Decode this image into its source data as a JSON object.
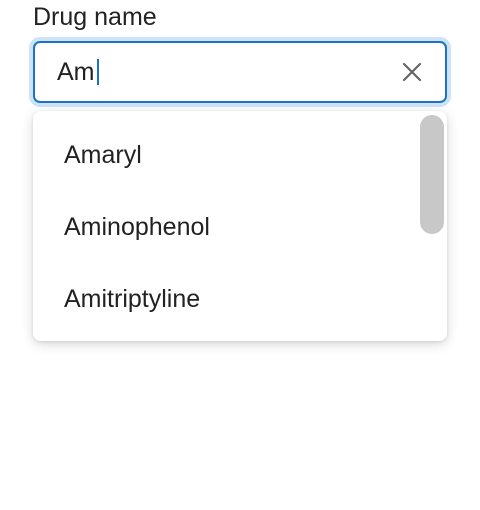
{
  "field": {
    "label": "Drug name",
    "value": "Am"
  },
  "icons": {
    "clear": "close-icon"
  },
  "colors": {
    "focus_border": "#1a73c9",
    "focus_ring": "#cfe3f7",
    "scrollbar_thumb": "#c8c8c8"
  },
  "dropdown": {
    "options": [
      "Amaryl",
      "Aminophenol",
      "Amitriptyline"
    ]
  }
}
